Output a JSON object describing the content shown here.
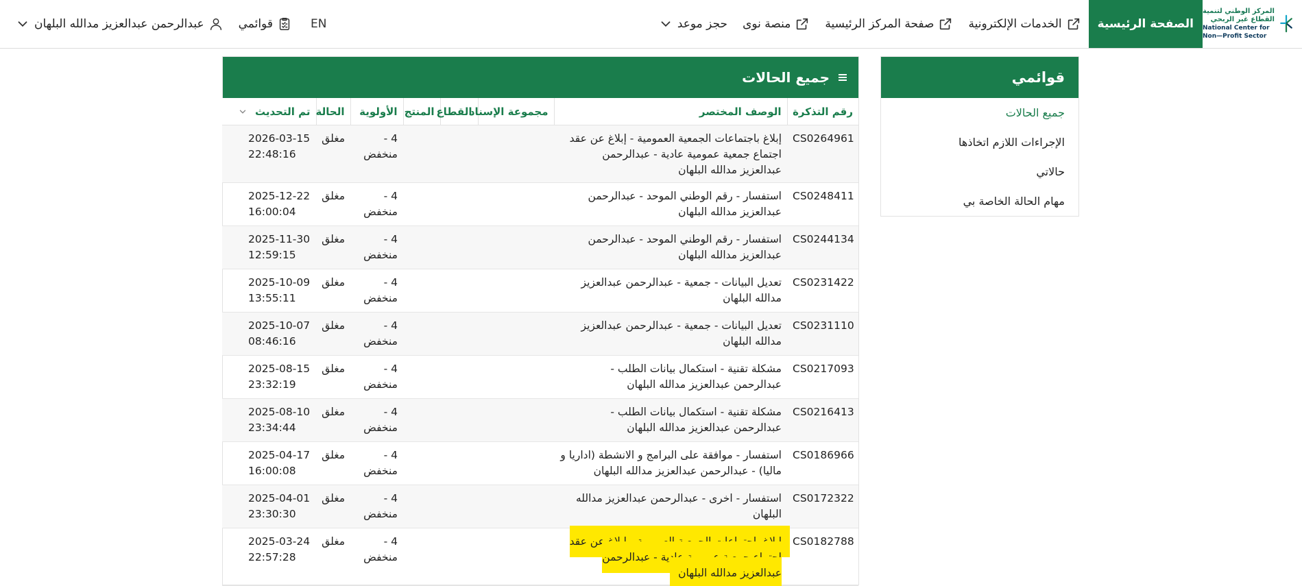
{
  "logo": {
    "ar_line1": "المركز الوطني لتنمية",
    "ar_line2": "القطاع غير الربحي",
    "en_line1": "National Center for",
    "en_line2": "Non—Profit Sector"
  },
  "nav": {
    "home": "الصفحة الرئيسية",
    "eservices": "الخدمات الإلكترونية",
    "center_home": "صفحة المركز الرئيسية",
    "nawa": "منصة نوى",
    "booking": "حجز موعد",
    "lang": "EN",
    "my_lists": "قوائمي",
    "user": "عبدالرحمن عبدالعزيز مدالله البلهان"
  },
  "side": {
    "title": "قوائمي",
    "items": [
      {
        "label": "جميع الحالات"
      },
      {
        "label": "الإجراءات اللازم اتخاذها"
      },
      {
        "label": "حالاتي"
      },
      {
        "label": "مهام الحالة الخاصة بي"
      }
    ]
  },
  "panel": {
    "title": "جميع الحالات",
    "columns": {
      "ticket": "رقم التذكرة",
      "desc": "الوصف المختصر",
      "group": "مجموعة الإسناد",
      "sector": "القطاع",
      "product": "المنتج",
      "priority": "الأولوية",
      "status": "الحالة",
      "updated": "تم التحديث"
    },
    "rows": [
      {
        "ticket": "CS0264961",
        "desc": "إبلاغ باجتماعات الجمعية العمومية - إبلاغ عن عقد اجتماع جمعية عمومية عادية - عبدالرحمن عبدالعزيز مدالله البلهان",
        "priority": "4 - منخفض",
        "status": "مغلق",
        "date": "2026-03-15",
        "time": "22:48:16"
      },
      {
        "ticket": "CS0248411",
        "desc": "استفسار - رقم الوطني الموحد - عبدالرحمن عبدالعزيز مدالله البلهان",
        "priority": "4 - منخفض",
        "status": "مغلق",
        "date": "2025-12-22",
        "time": "16:00:04"
      },
      {
        "ticket": "CS0244134",
        "desc": "استفسار - رقم الوطني الموحد - عبدالرحمن عبدالعزيز مدالله البلهان",
        "priority": "4 - منخفض",
        "status": "مغلق",
        "date": "2025-11-30",
        "time": "12:59:15"
      },
      {
        "ticket": "CS0231422",
        "desc": "تعديل البيانات - جمعية - عبدالرحمن عبدالعزيز مدالله البلهان",
        "priority": "4 - منخفض",
        "status": "مغلق",
        "date": "2025-10-09",
        "time": "13:55:11"
      },
      {
        "ticket": "CS0231110",
        "desc": "تعديل البيانات - جمعية - عبدالرحمن عبدالعزيز مدالله البلهان",
        "priority": "4 - منخفض",
        "status": "مغلق",
        "date": "2025-10-07",
        "time": "08:46:16"
      },
      {
        "ticket": "CS0217093",
        "desc": "مشكلة تقنية - استكمال بيانات الطلب - عبدالرحمن عبدالعزيز مدالله البلهان",
        "priority": "4 - منخفض",
        "status": "مغلق",
        "date": "2025-08-15",
        "time": "23:32:19"
      },
      {
        "ticket": "CS0216413",
        "desc": "مشكلة تقنية - استكمال بيانات الطلب - عبدالرحمن عبدالعزيز مدالله البلهان",
        "priority": "4 - منخفض",
        "status": "مغلق",
        "date": "2025-08-10",
        "time": "23:34:44"
      },
      {
        "ticket": "CS0186966",
        "desc": "استفسار - موافقة على البرامج و الانشطة (اداريا و ماليا) - عبدالرحمن عبدالعزيز مدالله البلهان",
        "priority": "4 - منخفض",
        "status": "مغلق",
        "date": "2025-04-17",
        "time": "16:00:08"
      },
      {
        "ticket": "CS0172322",
        "desc": "استفسار - اخرى - عبدالرحمن عبدالعزيز مدالله البلهان",
        "priority": "4 - منخفض",
        "status": "مغلق",
        "date": "2025-04-01",
        "time": "23:30:30"
      },
      {
        "ticket": "CS0182788",
        "desc": "إبلاغ باجتماعات الجمعية العمومية - إبلاغ عن عقد اجتماع جمعية عمومية عادية - عبدالرحمن عبدالعزيز مدالله البلهان",
        "priority": "4 - منخفض",
        "status": "مغلق",
        "date": "2025-03-24",
        "time": "22:57:28",
        "highlight": true
      }
    ]
  },
  "colors": {
    "brand_green": "#1a7d4c",
    "highlight": "#ffe800"
  }
}
